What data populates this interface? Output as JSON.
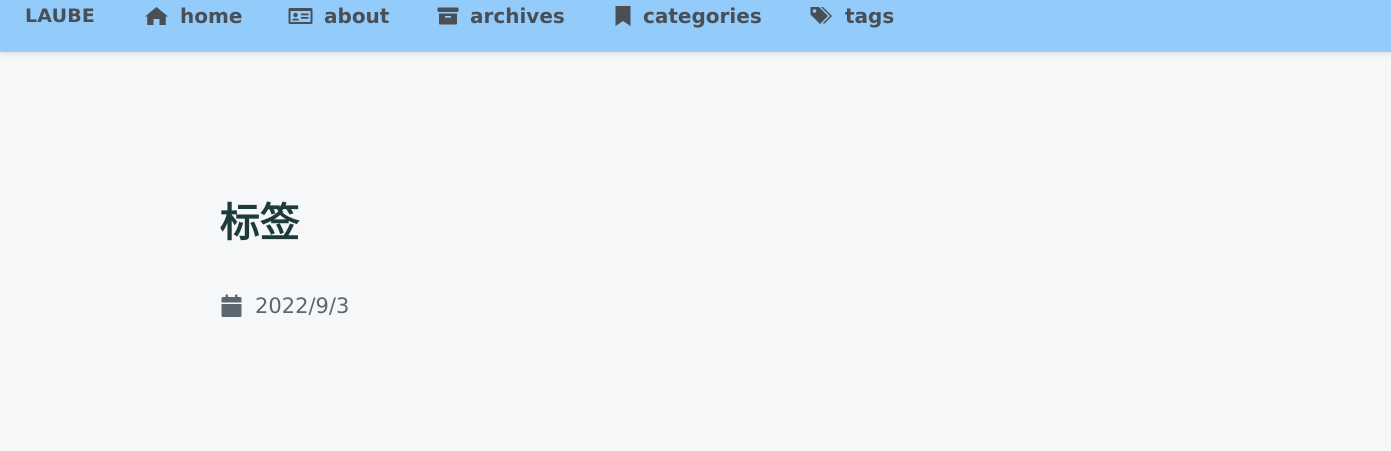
{
  "navbar": {
    "brand": "LAUBE",
    "items": [
      {
        "label": "home",
        "icon": "home-icon"
      },
      {
        "label": "about",
        "icon": "id-card-icon"
      },
      {
        "label": "archives",
        "icon": "archive-box-icon"
      },
      {
        "label": "categories",
        "icon": "bookmark-icon"
      },
      {
        "label": "tags",
        "icon": "tags-icon"
      }
    ],
    "background": "#93cbfa",
    "text_color": "#4a4f56"
  },
  "page": {
    "title": "标签",
    "date": "2022/9/3",
    "date_icon": "calendar-icon",
    "background": "#f6f7f9",
    "title_color": "#1f3a3a"
  }
}
